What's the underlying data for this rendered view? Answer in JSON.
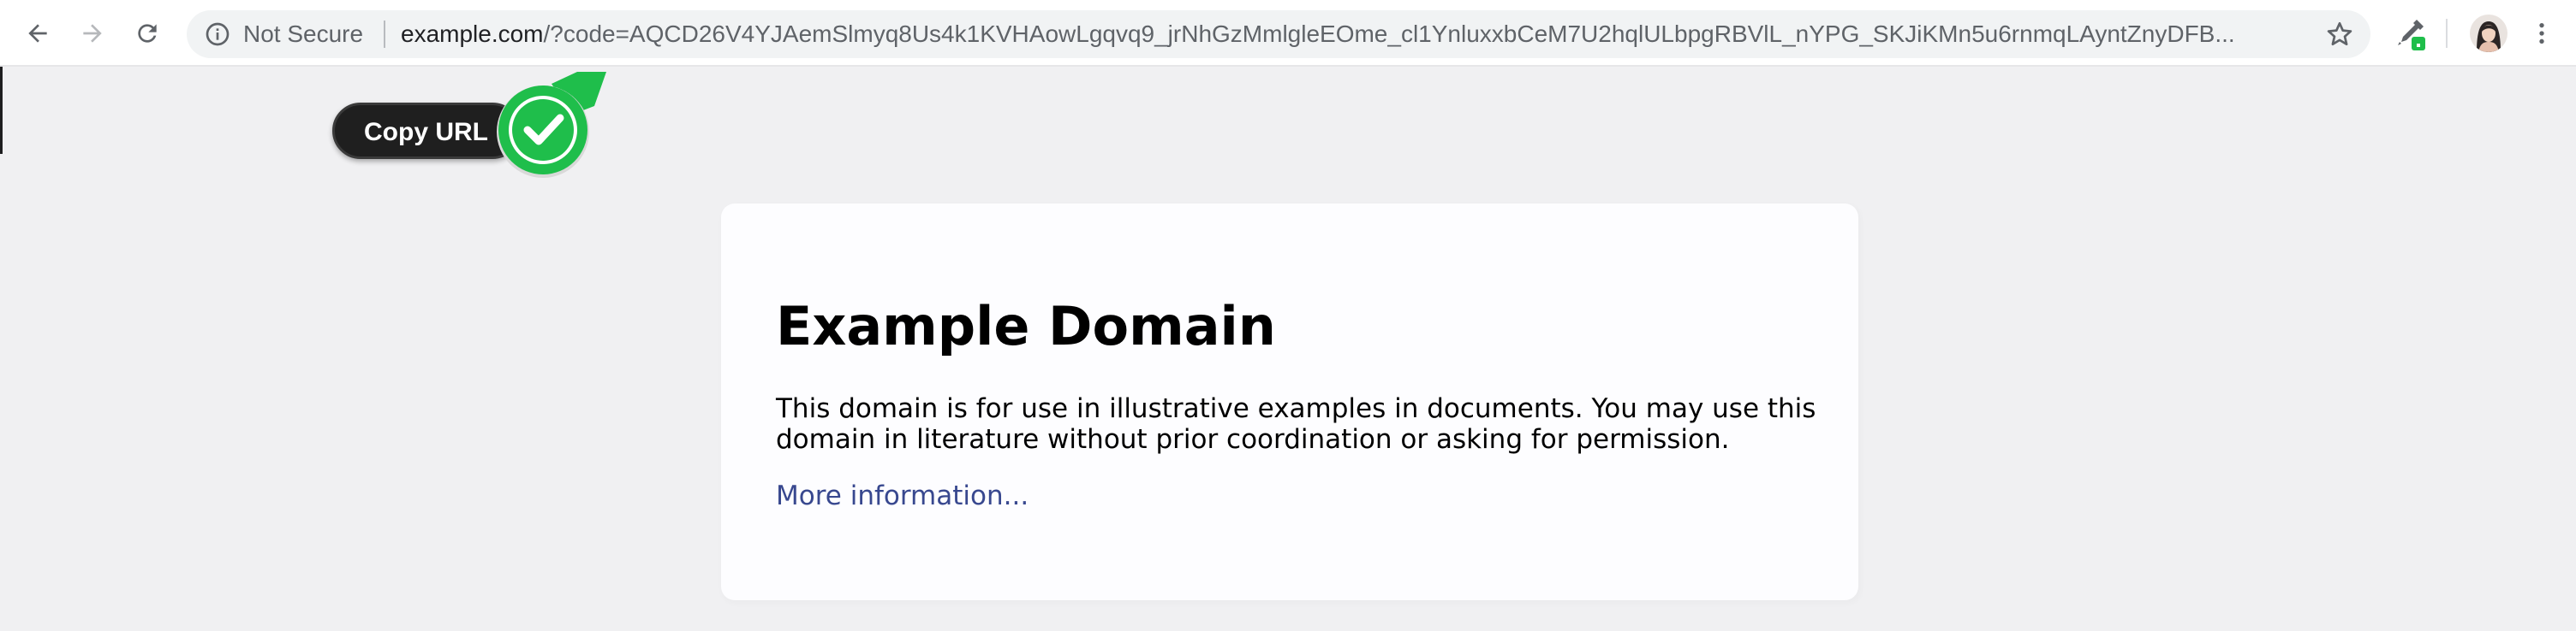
{
  "browser": {
    "security_status": "Not Secure",
    "url_host": "example.com",
    "url_path": "/?code=AQCD26V4YJAemSlmyq8Us4k1KVHAowLgqvq9_jrNhGzMmlgleEOme_cl1YnluxxbCeM7U2hqlULbpgRBVlL_nYPG_SKJiKMn5u6rnmqLAyntZnyDFB...",
    "icons": {
      "back": "back-arrow-icon",
      "forward": "forward-arrow-icon",
      "reload": "reload-icon",
      "info": "info-icon",
      "bookmark": "star-icon",
      "extension": "eyedropper-extension-icon",
      "menu": "kebab-menu-icon"
    }
  },
  "extension_popup": {
    "label": "Copy URL",
    "status_icon": "check-icon",
    "accent": "#1fbe4b"
  },
  "page": {
    "heading": "Example Domain",
    "description": "This domain is for use in illustrative examples in documents. You may use this domain in literature without prior coordination or asking for permission.",
    "link_text": "More information...",
    "link_color": "#38488f",
    "background": "#f0f0f2"
  }
}
